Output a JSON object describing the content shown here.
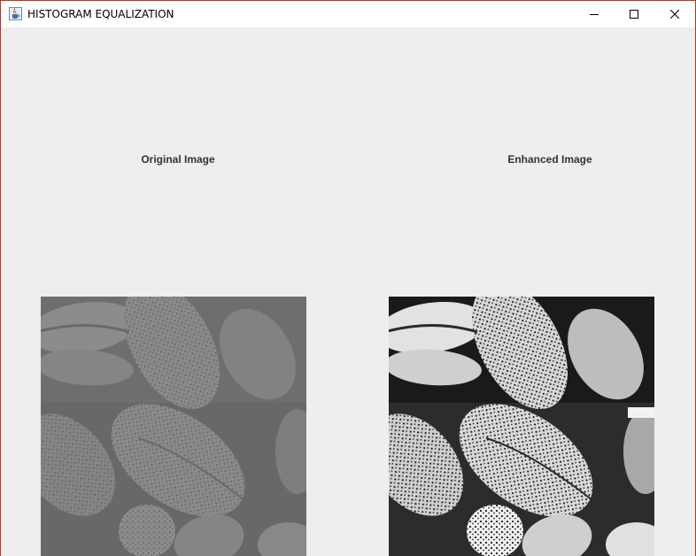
{
  "window": {
    "title": "HISTOGRAM EQUALIZATION",
    "app_icon": "java-coffee-cup-icon",
    "controls": {
      "minimize_icon": "minimize-icon",
      "maximize_icon": "maximize-icon",
      "close_icon": "close-icon"
    },
    "accent_border_color": "#c42b1c",
    "background_color": "#eeeeee"
  },
  "panels": {
    "original": {
      "label": "Original Image",
      "content": "low-contrast grayscale pollen grains photograph"
    },
    "enhanced": {
      "label": "Enhanced Image",
      "content": "histogram-equalized high-contrast grayscale pollen grains photograph"
    }
  }
}
